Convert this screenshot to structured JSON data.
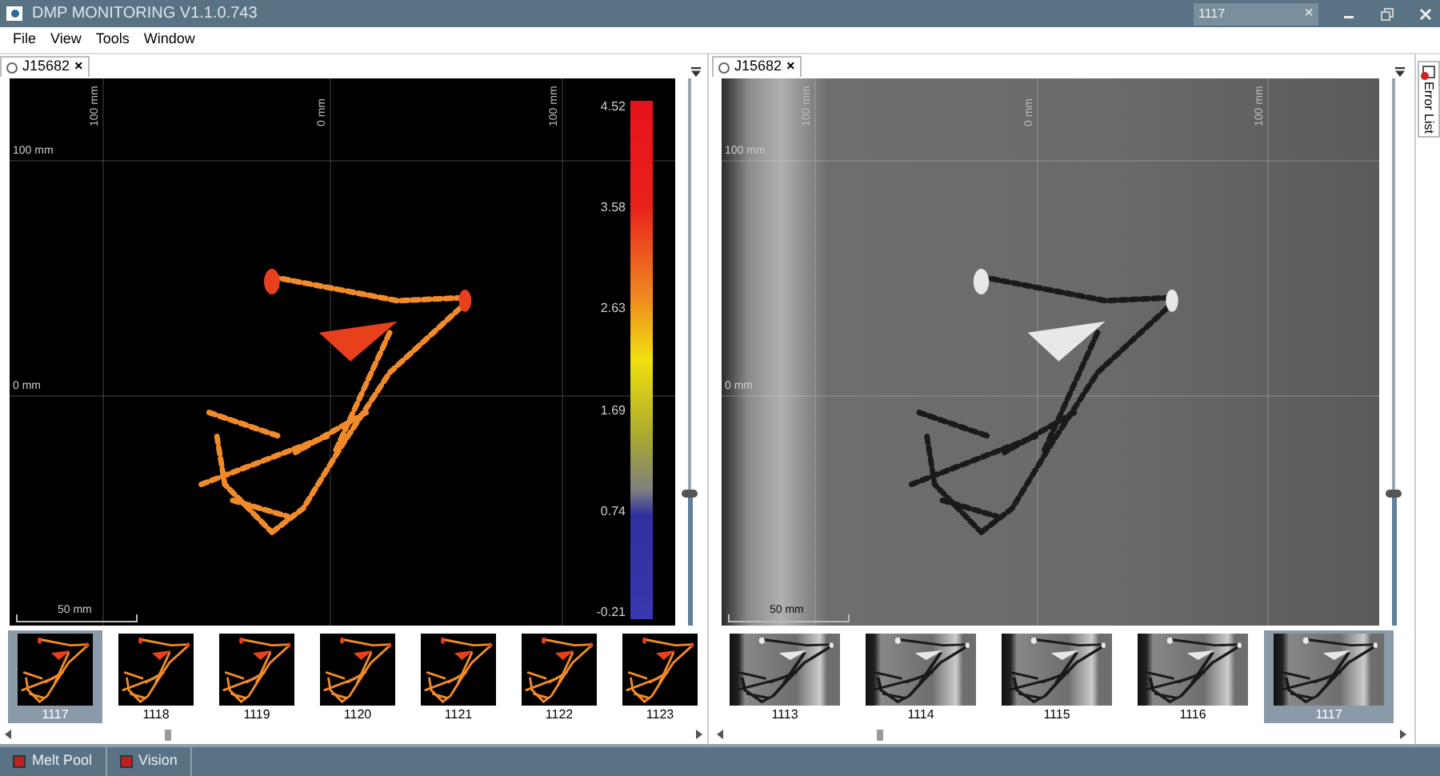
{
  "window": {
    "title": "DMP MONITORING V1.1.0.743",
    "search": {
      "value": "1117",
      "clear": "×"
    }
  },
  "menu": [
    "File",
    "View",
    "Tools",
    "Window"
  ],
  "panels": [
    {
      "kind": "meltpool",
      "tab": {
        "label": "J15682",
        "close": "×"
      },
      "axis_top": [
        "100 mm",
        "0 mm",
        "100 mm"
      ],
      "axis_left": [
        "100 mm",
        "0 mm"
      ],
      "scale": "50 mm",
      "colorbar": [
        "4.52",
        "3.58",
        "2.63",
        "1.69",
        "0.74",
        "-0.21"
      ],
      "slider": {
        "level": 0.24
      },
      "thumbnails": [
        {
          "label": "1117",
          "selected": true
        },
        {
          "label": "1118",
          "selected": false
        },
        {
          "label": "1119",
          "selected": false
        },
        {
          "label": "1120",
          "selected": false
        },
        {
          "label": "1121",
          "selected": false
        },
        {
          "label": "1122",
          "selected": false
        },
        {
          "label": "1123",
          "selected": false
        }
      ]
    },
    {
      "kind": "vision",
      "tab": {
        "label": "J15682",
        "close": "×"
      },
      "axis_top": [
        "100 mm",
        "0 mm",
        "100 mm"
      ],
      "axis_left": [
        "100 mm",
        "0 mm"
      ],
      "scale": "50 mm",
      "slider": {
        "level": 0.24
      },
      "thumbnails": [
        {
          "label": "1113",
          "selected": false
        },
        {
          "label": "1114",
          "selected": false
        },
        {
          "label": "1115",
          "selected": false
        },
        {
          "label": "1116",
          "selected": false
        },
        {
          "label": "1117",
          "selected": true
        }
      ]
    }
  ],
  "side_tab": "Error List",
  "bottom_tabs": [
    "Melt Pool",
    "Vision"
  ]
}
